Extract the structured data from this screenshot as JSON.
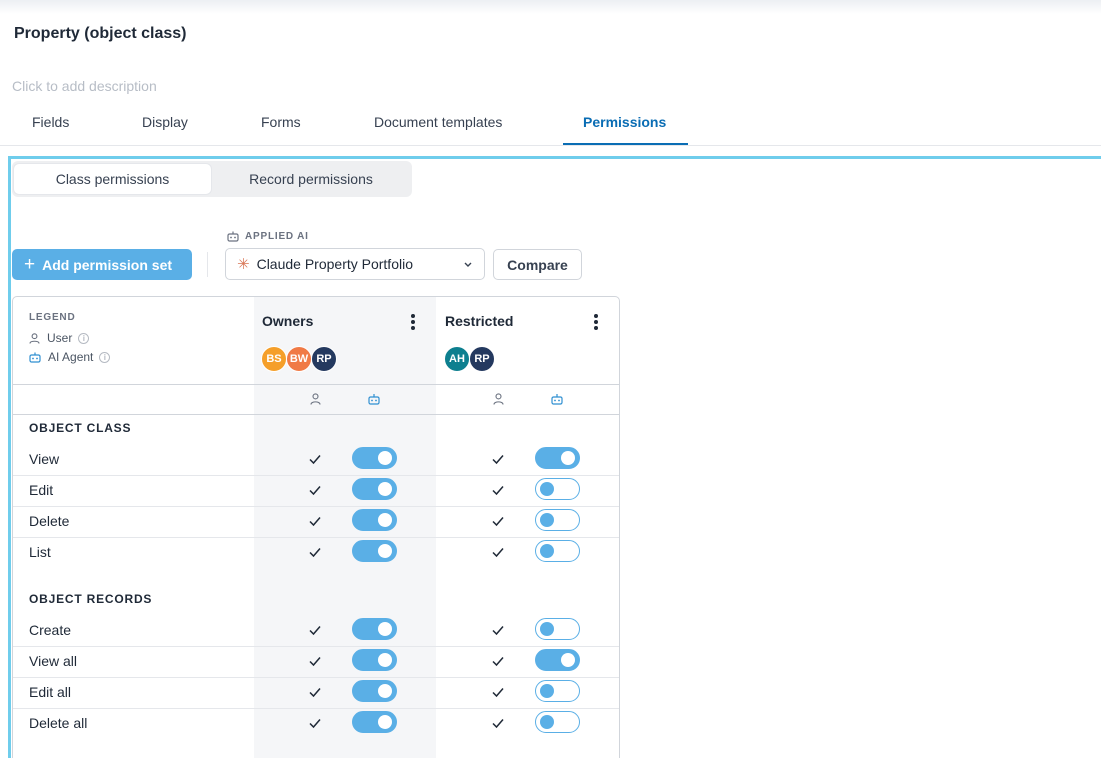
{
  "page": {
    "title": "Property (object class)",
    "description_placeholder": "Click to add description"
  },
  "tabs": [
    {
      "label": "Fields",
      "active": false
    },
    {
      "label": "Display",
      "active": false
    },
    {
      "label": "Forms",
      "active": false
    },
    {
      "label": "Document templates",
      "active": false
    },
    {
      "label": "Permissions",
      "active": true
    }
  ],
  "segmented": [
    {
      "label": "Class permissions",
      "active": true
    },
    {
      "label": "Record permissions",
      "active": false
    }
  ],
  "toolbar": {
    "add_label": "Add permission set",
    "applied_ai_label": "APPLIED AI",
    "selected_ai": "Claude Property Portfolio",
    "compare_label": "Compare"
  },
  "legend": {
    "heading": "LEGEND",
    "user": "User",
    "agent": "AI Agent"
  },
  "columns": [
    {
      "name": "Owners",
      "avatars": [
        {
          "initials": "BS",
          "color": "#f59f2a"
        },
        {
          "initials": "BW",
          "color": "#f07a46"
        },
        {
          "initials": "RP",
          "color": "#24395f"
        }
      ]
    },
    {
      "name": "Restricted",
      "avatars": [
        {
          "initials": "AH",
          "color": "#0d7f8f"
        },
        {
          "initials": "RP",
          "color": "#24395f"
        }
      ]
    }
  ],
  "sections": [
    {
      "title": "OBJECT CLASS",
      "rows": [
        {
          "label": "View",
          "owners": {
            "user": true,
            "agent": true
          },
          "restricted": {
            "user": true,
            "agent": true
          }
        },
        {
          "label": "Edit",
          "owners": {
            "user": true,
            "agent": true
          },
          "restricted": {
            "user": true,
            "agent": false
          }
        },
        {
          "label": "Delete",
          "owners": {
            "user": true,
            "agent": true
          },
          "restricted": {
            "user": true,
            "agent": false
          }
        },
        {
          "label": "List",
          "owners": {
            "user": true,
            "agent": true
          },
          "restricted": {
            "user": true,
            "agent": false
          }
        }
      ]
    },
    {
      "title": "OBJECT RECORDS",
      "rows": [
        {
          "label": "Create",
          "owners": {
            "user": true,
            "agent": true
          },
          "restricted": {
            "user": true,
            "agent": false
          }
        },
        {
          "label": "View all",
          "owners": {
            "user": true,
            "agent": true
          },
          "restricted": {
            "user": true,
            "agent": true
          }
        },
        {
          "label": "Edit all",
          "owners": {
            "user": true,
            "agent": true
          },
          "restricted": {
            "user": true,
            "agent": false
          }
        },
        {
          "label": "Delete all",
          "owners": {
            "user": true,
            "agent": true
          },
          "restricted": {
            "user": true,
            "agent": false
          }
        }
      ]
    }
  ],
  "colors": {
    "accent": "#0a6db4",
    "toggle": "#5aafe6",
    "frame": "#6fcdec"
  }
}
